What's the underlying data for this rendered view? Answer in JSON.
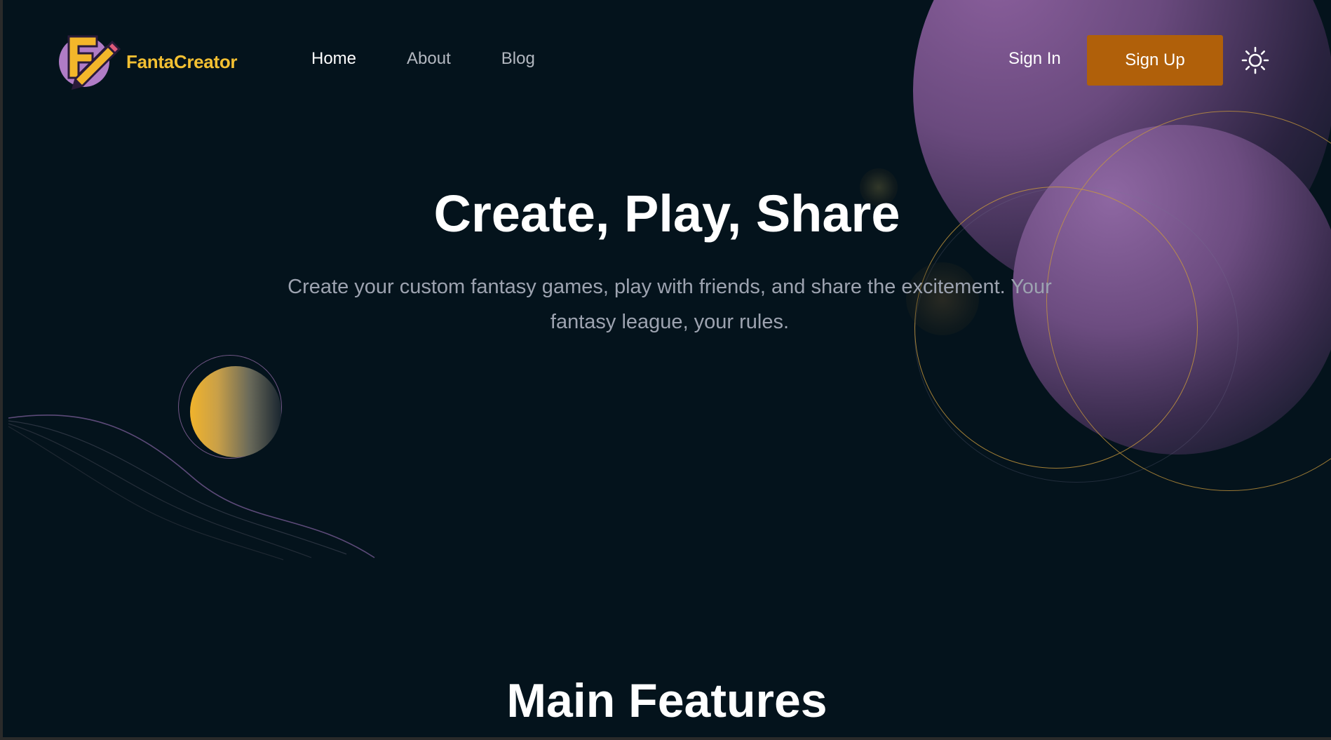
{
  "brand": {
    "name": "FantaCreator",
    "logo_icon": "f-pencil-logo-icon"
  },
  "nav": {
    "links": [
      {
        "label": "Home",
        "active": true
      },
      {
        "label": "About",
        "active": false
      },
      {
        "label": "Blog",
        "active": false
      }
    ],
    "sign_in": "Sign In",
    "sign_up": "Sign Up",
    "theme_icon": "sun-icon"
  },
  "hero": {
    "title": "Create, Play, Share",
    "subtitle": "Create your custom fantasy games, play with friends, and share the excitement. Your fantasy league, your rules."
  },
  "features": {
    "title": "Main Features"
  },
  "colors": {
    "background": "#04131c",
    "accent": "#b0600a",
    "brand_yellow": "#f3c032",
    "planet_purple": "#8a5f9c",
    "gold": "#c99a3c"
  }
}
